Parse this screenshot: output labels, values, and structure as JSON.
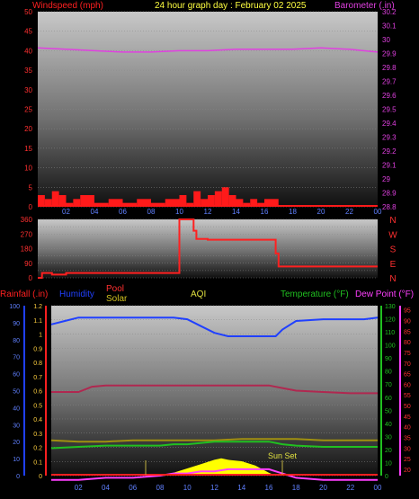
{
  "header": {
    "wind_label": "Windspeed (mph)",
    "date_title": "24 hour graph day : February 02 2025",
    "baro_label": "Barometer (.in)"
  },
  "colors": {
    "wind": "#ff1a1a",
    "baro": "#e040e0",
    "wind_dir": "#ff2020",
    "rain": "#ff2020",
    "humidity": "#2040ff",
    "pool": "#ff3030",
    "solar": "#f0f040",
    "aqi": "#e0e040",
    "temperature": "#20c020",
    "dewpoint": "#ff40ff"
  },
  "labels": {
    "rainfall": "Rainfall (.in)",
    "humidity": "Humidity",
    "pool": "Pool",
    "solar": "Solar",
    "aqi": "AQI",
    "temperature": "Temperature (°F)",
    "dewpoint": "Dew Point (°F)",
    "sunset": "Sun Set"
  },
  "chart_data": [
    {
      "type": "line",
      "title": "24 hour graph day : February 02 2025",
      "x_ticks": [
        "02",
        "04",
        "06",
        "08",
        "10",
        "12",
        "14",
        "16",
        "18",
        "20",
        "22",
        "00"
      ],
      "y_left": {
        "label": "Windspeed (mph)",
        "ticks": [
          0,
          5,
          10,
          15,
          20,
          25,
          30,
          35,
          40,
          45,
          50
        ],
        "range": [
          0,
          50
        ]
      },
      "y_right": {
        "label": "Barometer (.in)",
        "ticks": [
          "28.8",
          "28.9",
          "29",
          "29.1",
          "29.2",
          "29.3",
          "29.4",
          "29.5",
          "29.6",
          "29.7",
          "29.8",
          "29.9",
          "30",
          "30.1",
          "30.2"
        ],
        "range": [
          28.8,
          30.2
        ]
      },
      "series": [
        {
          "name": "Barometer (.in)",
          "axis": "right",
          "x_hours": [
            0,
            2,
            4,
            6,
            8,
            10,
            12,
            14,
            16,
            18,
            20,
            22,
            23,
            24
          ],
          "values": [
            29.94,
            29.93,
            29.92,
            29.91,
            29.91,
            29.92,
            29.92,
            29.93,
            29.93,
            29.93,
            29.94,
            29.93,
            29.92,
            29.91
          ]
        },
        {
          "name": "Windspeed (mph)",
          "axis": "left",
          "x_hours": [
            0,
            0.5,
            1,
            1.5,
            2,
            2.5,
            3,
            4,
            5,
            6,
            7,
            8,
            9,
            10,
            10.5,
            11,
            11.5,
            12,
            12.5,
            13,
            13.5,
            14,
            14.5,
            15,
            15.5,
            16,
            17,
            18,
            20,
            22,
            24
          ],
          "values": [
            3,
            2,
            4,
            3,
            1,
            2,
            3,
            1,
            2,
            1,
            2,
            1,
            2,
            3,
            1,
            4,
            2,
            3,
            4,
            5,
            3,
            2,
            1,
            2,
            1,
            2,
            0,
            0,
            0,
            0,
            0
          ]
        }
      ]
    },
    {
      "type": "line",
      "y_left": {
        "ticks": [
          0,
          45,
          90,
          135,
          180,
          225,
          270,
          315,
          360
        ],
        "range": [
          0,
          360
        ]
      },
      "y_right": {
        "ticks": [
          "N",
          "W",
          "S",
          "E",
          "N"
        ]
      },
      "series": [
        {
          "name": "Wind Direction",
          "x_hours": [
            0,
            0.3,
            1,
            2,
            4,
            6,
            8,
            9.9,
            10,
            11,
            11.2,
            12,
            14,
            16,
            16.8,
            17,
            20,
            24
          ],
          "values": [
            0,
            30,
            20,
            30,
            30,
            30,
            30,
            30,
            360,
            290,
            240,
            235,
            235,
            235,
            150,
            70,
            70,
            70
          ]
        }
      ]
    },
    {
      "type": "line",
      "y_rain": {
        "label": "Rainfall (.in)",
        "ticks": [
          "0",
          "0.1",
          "0.2",
          "0.3",
          "0.4",
          "0.5",
          "0.6",
          "0.7",
          "0.8",
          "0.9",
          "1",
          "1.1",
          "1.2"
        ],
        "range": [
          0,
          1.2
        ]
      },
      "y_left_hum": {
        "label": "Humidity",
        "ticks": [
          0,
          10,
          20,
          30,
          40,
          50,
          60,
          70,
          80,
          90,
          100
        ],
        "range": [
          0,
          100
        ]
      },
      "y_temp": {
        "label": "Temperature (°F)",
        "ticks": [
          0,
          10,
          20,
          30,
          40,
          50,
          60,
          70,
          80,
          90,
          100,
          110,
          120,
          130
        ],
        "range": [
          0,
          130
        ]
      },
      "y_dew": {
        "label": "Dew Point (°F)",
        "ticks": [
          20,
          25,
          30,
          35,
          40,
          45,
          50,
          55,
          60,
          65,
          70,
          75,
          80,
          85,
          90,
          95
        ],
        "range": [
          17,
          97
        ]
      },
      "series": [
        {
          "name": "Humidity",
          "x_hours": [
            0,
            1,
            2,
            4,
            6,
            8,
            9,
            10,
            11,
            12,
            13,
            14,
            15,
            16,
            16.5,
            17,
            18,
            20,
            22,
            23,
            24
          ],
          "values": [
            89,
            91,
            93,
            93,
            93,
            93,
            93,
            92,
            88,
            84,
            82,
            82,
            82,
            82,
            82,
            86,
            91,
            92,
            92,
            92,
            93
          ]
        },
        {
          "name": "Pool",
          "x_hours": [
            0,
            2,
            3,
            4,
            6,
            8,
            10,
            12,
            14,
            16,
            17,
            18,
            20,
            22,
            24
          ],
          "values": [
            64,
            64,
            68,
            69,
            69,
            69,
            69,
            69,
            69,
            69,
            67,
            65,
            64,
            63,
            63
          ]
        },
        {
          "name": "Solar",
          "x_hours": [
            0,
            2,
            4,
            6,
            8,
            10,
            12,
            14,
            16,
            18,
            20,
            22,
            24
          ],
          "values": [
            27,
            26,
            26,
            27,
            27,
            27,
            27,
            28,
            28,
            28,
            27,
            27,
            27
          ]
        },
        {
          "name": "Temperature (°F)",
          "x_hours": [
            0,
            2,
            4,
            6,
            8,
            9,
            10,
            12,
            14,
            15,
            16,
            17,
            18,
            20,
            22,
            24
          ],
          "values": [
            21,
            22,
            23,
            23,
            23,
            24,
            24,
            26,
            26,
            26,
            26,
            24,
            23,
            22,
            22,
            22
          ]
        },
        {
          "name": "Dew Point (°F)",
          "x_hours": [
            0,
            2,
            4,
            6,
            8,
            9,
            10,
            11,
            12,
            13,
            14,
            15,
            16,
            17,
            18,
            20,
            22,
            24
          ],
          "values": [
            15,
            15,
            16,
            16,
            17,
            18,
            18,
            19,
            19,
            20,
            20,
            20,
            20,
            18,
            16,
            15,
            15,
            15
          ]
        },
        {
          "name": "Solar Radiation",
          "x_hours": [
            8,
            9,
            10,
            11,
            12,
            12.5,
            13,
            14,
            15,
            16,
            16.5
          ],
          "values": [
            0,
            2,
            5,
            8,
            11,
            12,
            11,
            10,
            7,
            2,
            0
          ]
        },
        {
          "name": "Rainfall (.in)",
          "x_hours": [
            0,
            24
          ],
          "values": [
            0,
            0
          ]
        }
      ],
      "annotations": [
        "Sun Set"
      ]
    }
  ]
}
